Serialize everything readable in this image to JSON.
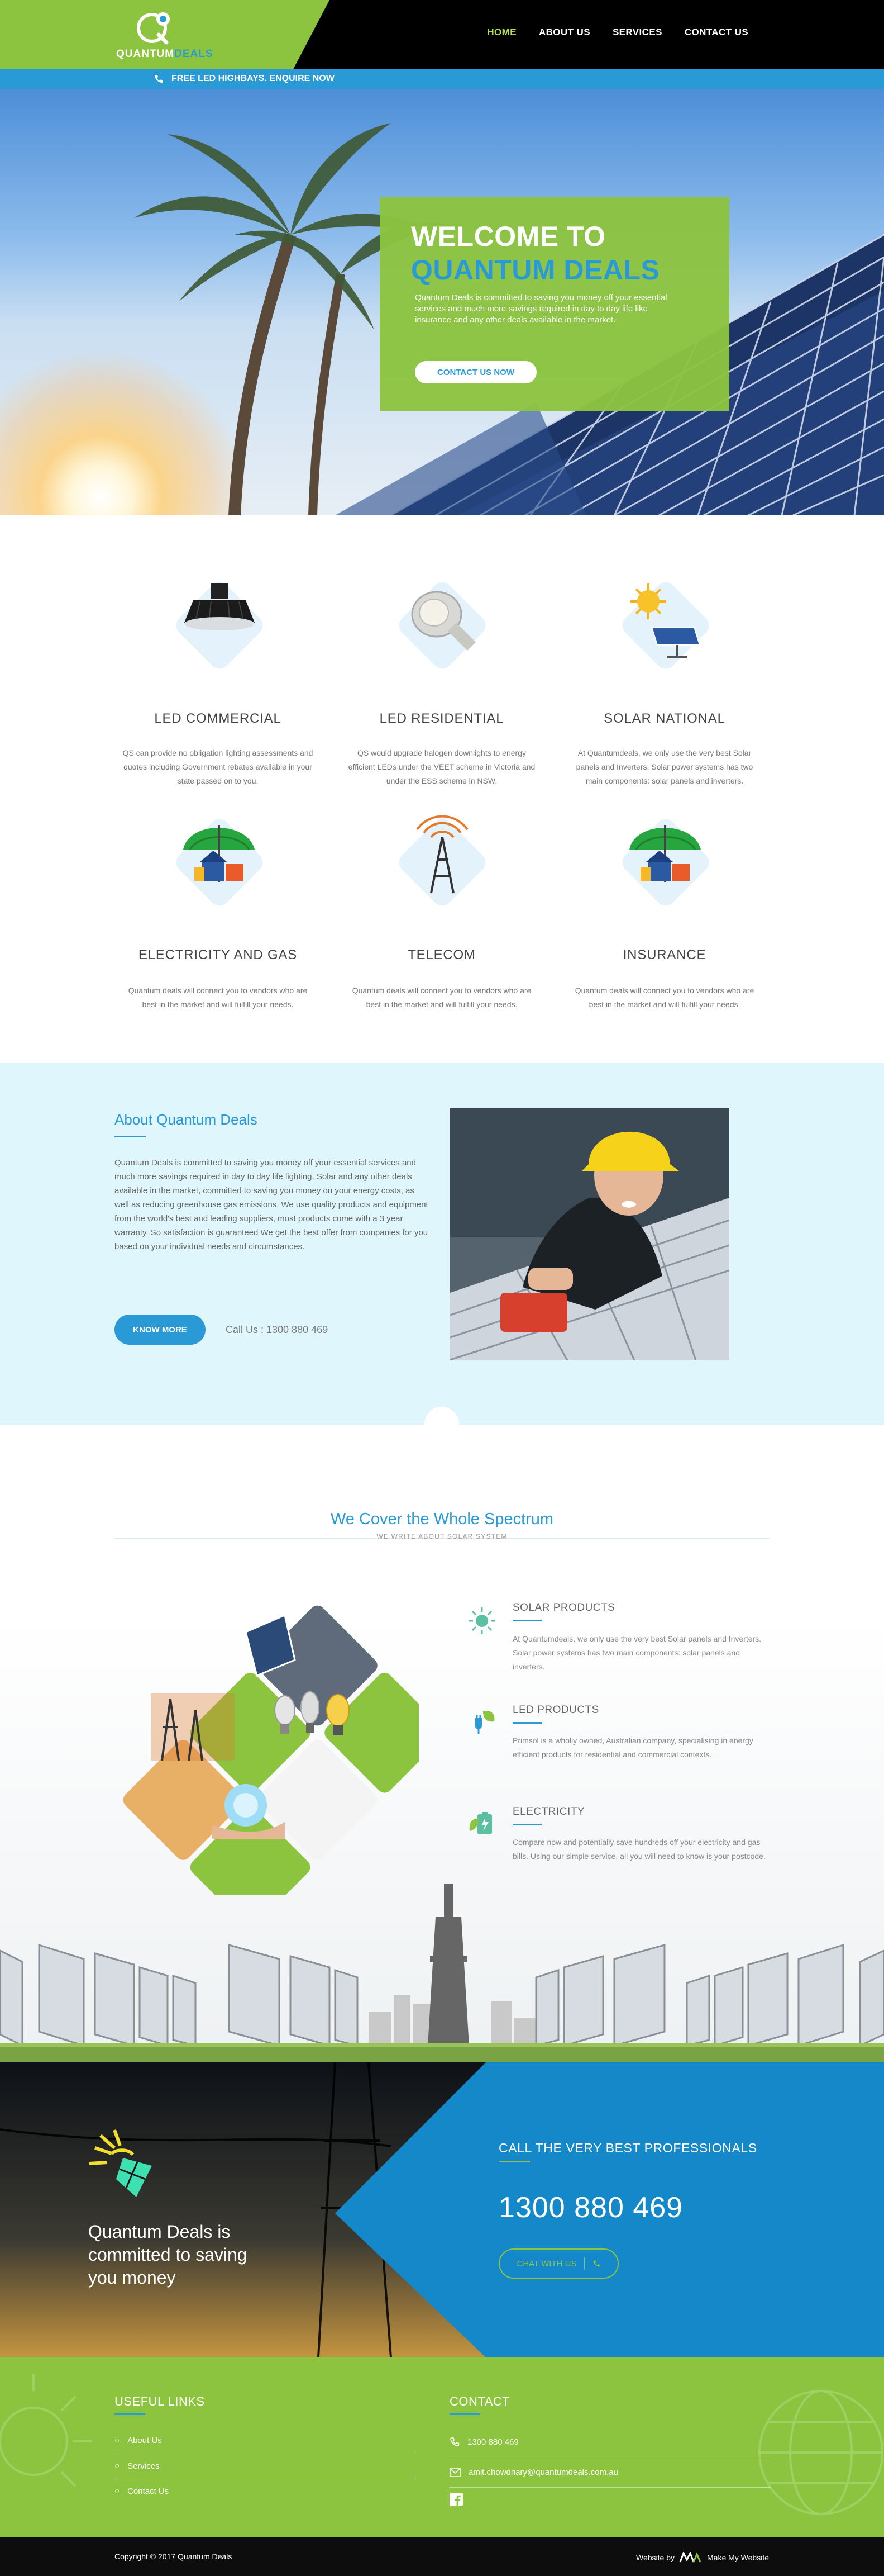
{
  "brand": {
    "name_light": "QUANTUM",
    "name_bold": "DEALS",
    "green": "#8cc43f",
    "blue": "#2a9ad6"
  },
  "nav": {
    "items": [
      {
        "label": "HOME",
        "active": true
      },
      {
        "label": "ABOUT US",
        "active": false
      },
      {
        "label": "SERVICES",
        "active": false
      },
      {
        "label": "CONTACT US",
        "active": false
      }
    ]
  },
  "promo": {
    "text": "FREE LED HIGHBAYS. ENQUIRE NOW",
    "icon": "phone-icon"
  },
  "hero": {
    "title_line1": "WELCOME TO",
    "title_line2": "QUANTUM DEALS",
    "description": "Quantum Deals is committed to saving you money off your essential services and much more savings required in day to day life like insurance and any other deals available in the market.",
    "cta": "CONTACT US NOW"
  },
  "services": [
    {
      "title": "LED COMMERCIAL",
      "icon": "highbay-light-icon",
      "text": "QS can provide no obligation lighting assessments and quotes including Government rebates available in your state passed on to you."
    },
    {
      "title": "LED RESIDENTIAL",
      "icon": "downlight-bulb-icon",
      "text": "QS would upgrade halogen downlights to energy efficient LEDs under the VEET scheme in Victoria and under the ESS scheme in NSW."
    },
    {
      "title": "SOLAR NATIONAL",
      "icon": "solar-panel-sun-icon",
      "text": "At Quantumdeals, we only use the very best Solar panels and Inverters. Solar power systems  has two main components: solar panels and inverters."
    },
    {
      "title": "ELECTRICITY AND GAS",
      "icon": "umbrella-house-icon",
      "text": "Quantum deals will connect you to vendors who are best in the market and will fulfill your needs."
    },
    {
      "title": "TELECOM",
      "icon": "telecom-tower-icon",
      "text": "Quantum deals will connect you to vendors who are best in the market and will fulfill your needs."
    },
    {
      "title": "INSURANCE",
      "icon": "umbrella-house-icon",
      "text": "Quantum deals will connect you to vendors who are best in the market and will fulfill your needs."
    }
  ],
  "about": {
    "title": "About Quantum Deals",
    "text": "Quantum Deals is committed to saving you money off your essential services and much more savings required in day to day life lighting, Solar and any other deals available in the market, committed to saving you money on your energy costs, as well as reducing greenhouse gas emissions. We use quality products and equipment from the world's best and leading suppliers, most products come with a 3 year warranty. So satisfaction is guaranteed We get the best offer from companies for you based on your individual needs and circumstances.",
    "button": "KNOW MORE",
    "call": "Call Us : 1300 880 469"
  },
  "spectrum": {
    "title": "We Cover the Whole Spectrum",
    "subtitle": "WE WRITE ABOUT SOLAR SYSTEM",
    "features": [
      {
        "title": "SOLAR PRODUCTS",
        "icon": "sun-icon",
        "text": "At Quantumdeals, we only use the very best Solar panels and Inverters. Solar power systems  has two main components: solar panels and inverters."
      },
      {
        "title": "LED PRODUCTS",
        "icon": "plug-leaf-icon",
        "text": "Primsol is a wholly owned, Australian company, specialising in energy efficient products for residential and commercial contexts."
      },
      {
        "title": "ELECTRICITY",
        "icon": "battery-leaf-icon",
        "text": "Compare now and potentially save hundreds off your electricity and gas bills. Using our simple service, all you will need to know is your postcode."
      }
    ]
  },
  "callout": {
    "left_text": "Quantum Deals is committed to saving you money",
    "heading": "CALL THE VERY BEST PROFESSIONALS",
    "phone": "1300 880 469",
    "chat": "CHAT WITH US"
  },
  "footer": {
    "links_title": "USEFUL LINKS",
    "links": [
      "About Us",
      "Services",
      "Contact Us"
    ],
    "contact_title": "CONTACT",
    "phone": "1300 880 469",
    "email": "amit.chowdhary@quantumdeals.com.au",
    "copyright": "Copyright © 2017 Quantum Deals",
    "made_by_prefix": "Website by",
    "made_by": "Make My Website"
  }
}
